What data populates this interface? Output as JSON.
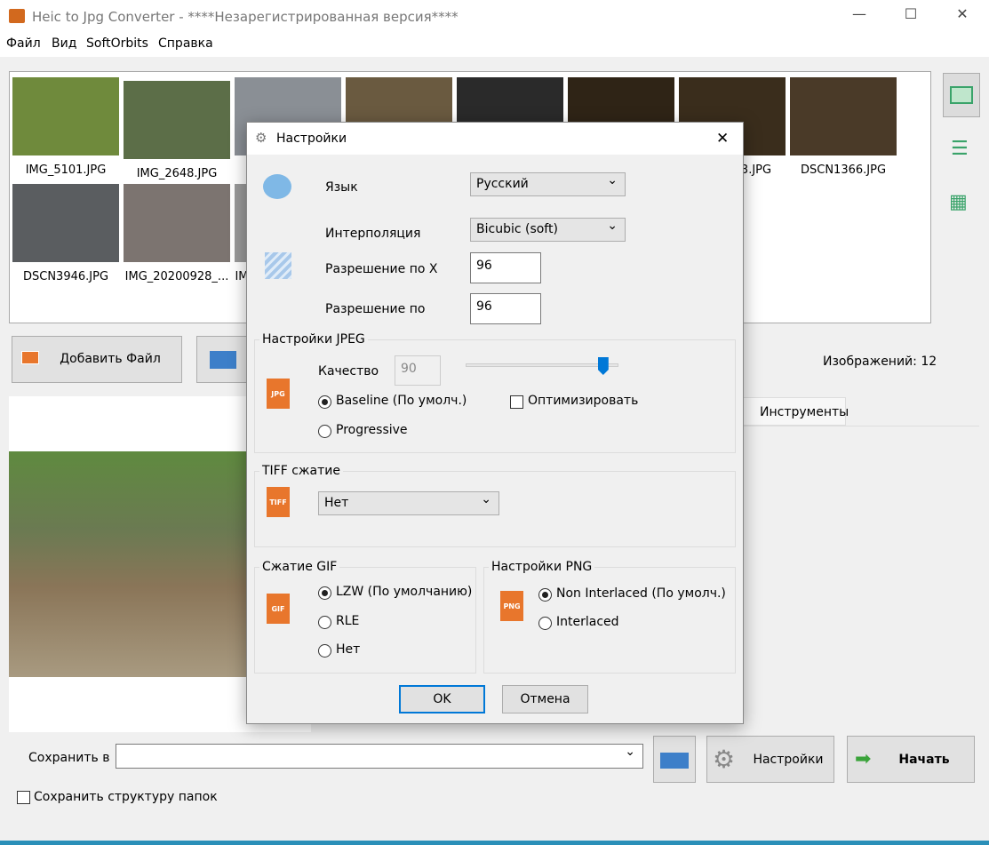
{
  "window": {
    "title": "Heic to Jpg Converter - ****Незарегистрированная версия****"
  },
  "menu": [
    "Файл",
    "Вид",
    "SoftOrbits",
    "Справка"
  ],
  "thumbnails": [
    {
      "name": "IMG_5101.JPG",
      "color": "#6f8a3c"
    },
    {
      "name": "IMG_2648.JPG",
      "color": "#5c6e48"
    },
    {
      "name": "",
      "color": "#8a8f95"
    },
    {
      "name": "",
      "color": "#6a5a40"
    },
    {
      "name": "",
      "color": "#2a2a2a"
    },
    {
      "name": "",
      "color": "#2f2416"
    },
    {
      "name": "3.JPG",
      "color": "#3a2d1c"
    },
    {
      "name": "DSCN1366.JPG",
      "color": "#4a3a28"
    },
    {
      "name": "DSCN3946.JPG",
      "color": "#5a5d60"
    },
    {
      "name": "IMG_20200928_...",
      "color": "#7c7470"
    },
    {
      "name": "IM",
      "color": "#999"
    }
  ],
  "buttons": {
    "add_file": "Добавить Файл",
    "settings": "Настройки",
    "start": "Начать"
  },
  "image_count": "Изображений: 12",
  "tabs": {
    "tools": "Инструменты"
  },
  "save": {
    "label": "Сохранить в",
    "value": "",
    "keep_structure": "Сохранить структуру папок"
  },
  "dialog": {
    "title": "Настройки",
    "language_label": "Язык",
    "language": "Русский",
    "interp_label": "Интерполяция",
    "interp": "Bicubic (soft)",
    "resx_label": "Разрешение по X",
    "resx": "96",
    "resy_label": "Разрешение по",
    "resy": "96",
    "jpeg_group": "Настройки JPEG",
    "quality_label": "Качество",
    "quality": "90",
    "quality_slider": 90,
    "baseline": "Baseline (По умолч.)",
    "progressive": "Progressive",
    "optimize": "Оптимизировать",
    "tiff_group": "TIFF сжатие",
    "tiff": "Нет",
    "gif_group": "Сжатие GIF",
    "gif_lzw": "LZW (По умолчанию)",
    "gif_rle": "RLE",
    "gif_none": "Нет",
    "png_group": "Настройки PNG",
    "png_non": "Non Interlaced (По умолч.)",
    "png_inter": "Interlaced",
    "ok": "OK",
    "cancel": "Отмена",
    "jpg_icon": "JPG",
    "tiff_icon": "TIFF",
    "gif_icon": "GIF",
    "png_icon": "PNG"
  },
  "colors": {
    "accent": "#0078d7",
    "file_icon": "#e8762c",
    "start_arrow": "#3aa33a"
  }
}
